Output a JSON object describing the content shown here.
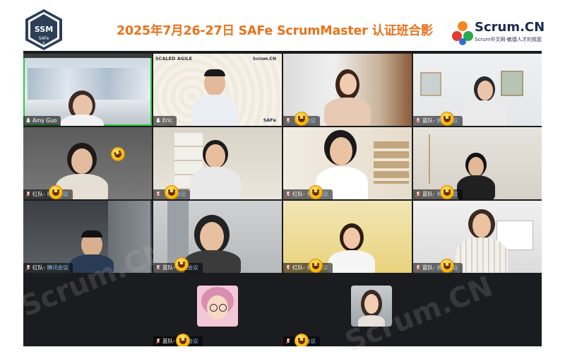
{
  "header": {
    "badge_top": "SSM",
    "badge_bottom": "SAFe",
    "badge_num": "6",
    "title": "2025年7月26-27日 SAFe ScrumMaster 认证班合影",
    "brand_name": "Scrum.CN",
    "brand_tagline": "Scrum中文网-敏捷人才的摇篮",
    "title_color": "#e8731c",
    "brand_color": "#1d2b4f"
  },
  "slide": {
    "logo_left": "SCALED AGILE",
    "logo_right": "Scrum.CN",
    "footer": "SAFe"
  },
  "watermark": "Scrum.CN",
  "meeting_app": "腾讯会议",
  "tiles": [
    {
      "name": "Amy Guo",
      "app": "",
      "mic": "on"
    },
    {
      "name": "Eric",
      "app": "",
      "mic": "on"
    },
    {
      "name": "",
      "app": "腾讯会议",
      "mic": "muted"
    },
    {
      "name": "蓝队-",
      "app": "腾讯会议",
      "mic": "muted"
    },
    {
      "name": "红队-",
      "app": "腾讯会议",
      "mic": "muted"
    },
    {
      "name": "",
      "app": "腾讯会议",
      "mic": "muted"
    },
    {
      "name": "红队-",
      "app": "腾讯会议",
      "mic": "muted"
    },
    {
      "name": "蓝队-",
      "app": "腾讯会议",
      "mic": "muted"
    },
    {
      "name": "红队-",
      "app": "腾讯会议",
      "mic": "muted"
    },
    {
      "name": "蓝队-",
      "app": "腾讯会议",
      "mic": "muted"
    },
    {
      "name": "红队-",
      "app": "腾讯会议",
      "mic": "muted"
    },
    {
      "name": "蓝队-",
      "app": "腾讯会议",
      "mic": "muted"
    },
    {
      "name": "蓝队-",
      "app": "腾讯会议",
      "mic": "muted"
    },
    {
      "name": "",
      "app": "腾讯会议",
      "mic": "muted"
    }
  ]
}
